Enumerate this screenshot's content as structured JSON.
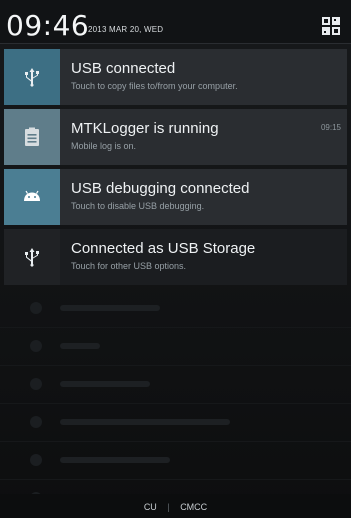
{
  "header": {
    "time": "09:46",
    "date": "2013 MAR 20, WED",
    "settings_icon": "quick-settings-icon"
  },
  "notifications": [
    {
      "title": "USB connected",
      "subtitle": "Touch to copy files to/from your computer.",
      "time": "",
      "icon": "usb-icon",
      "accent": "#3d6f84"
    },
    {
      "title": "MTKLogger is running",
      "subtitle": "Mobile log is on.",
      "time": "09:15",
      "icon": "log-icon",
      "accent": "#5f7d8a"
    },
    {
      "title": "USB debugging connected",
      "subtitle": "Touch to disable USB debugging.",
      "time": "",
      "icon": "android-icon",
      "accent": "#4b7e93"
    },
    {
      "title": "Connected as USB Storage",
      "subtitle": "Touch for other USB options.",
      "time": "",
      "icon": "usb-icon",
      "accent": "#202225"
    }
  ],
  "carrier": {
    "left": "CU",
    "separator": "|",
    "right": "CMCC"
  }
}
